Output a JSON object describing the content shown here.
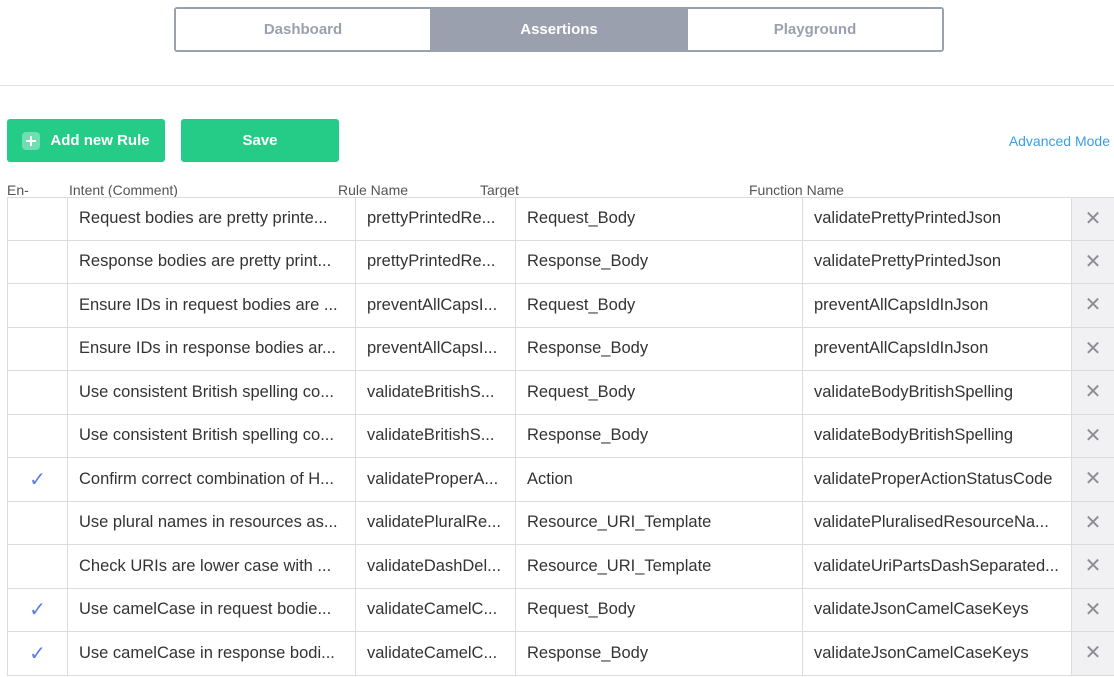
{
  "tabs": [
    {
      "label": "Dashboard",
      "active": false
    },
    {
      "label": "Assertions",
      "active": true
    },
    {
      "label": "Playground",
      "active": false
    }
  ],
  "toolbar": {
    "add_rule_label": "Add new Rule",
    "save_label": "Save",
    "advanced_mode_label": "Advanced Mode"
  },
  "columns": {
    "enabled": "En-",
    "intent": "Intent (Comment)",
    "rule_name": "Rule Name",
    "target": "Target",
    "function_name": "Function Name"
  },
  "rows": [
    {
      "enabled": "",
      "intent": "Request bodies are pretty printe...",
      "rule_name": "prettyPrintedRe...",
      "target": "Request_Body",
      "function_name": "validatePrettyPrintedJson",
      "delete": "✕"
    },
    {
      "enabled": "",
      "intent": "Response bodies are pretty print...",
      "rule_name": "prettyPrintedRe...",
      "target": "Response_Body",
      "function_name": "validatePrettyPrintedJson",
      "delete": "✕"
    },
    {
      "enabled": "",
      "intent": "Ensure IDs in request bodies are ...",
      "rule_name": "preventAllCapsI...",
      "target": "Request_Body",
      "function_name": "preventAllCapsIdInJson",
      "delete": "✕"
    },
    {
      "enabled": "",
      "intent": "Ensure IDs in response bodies ar...",
      "rule_name": "preventAllCapsI...",
      "target": "Response_Body",
      "function_name": "preventAllCapsIdInJson",
      "delete": "✕"
    },
    {
      "enabled": "",
      "intent": "Use consistent British spelling co...",
      "rule_name": "validateBritishS...",
      "target": "Request_Body",
      "function_name": "validateBodyBritishSpelling",
      "delete": "✕"
    },
    {
      "enabled": "",
      "intent": "Use consistent British spelling co...",
      "rule_name": "validateBritishS...",
      "target": "Response_Body",
      "function_name": "validateBodyBritishSpelling",
      "delete": "✕"
    },
    {
      "enabled": "✓",
      "intent": "Confirm correct combination of H...",
      "rule_name": "validateProperA...",
      "target": "Action",
      "function_name": "validateProperActionStatusCode",
      "delete": "✕"
    },
    {
      "enabled": "",
      "intent": "Use plural names in resources as...",
      "rule_name": "validatePluralRe...",
      "target": "Resource_URI_Template",
      "function_name": "validatePluralisedResourceNa...",
      "delete": "✕"
    },
    {
      "enabled": "",
      "intent": "Check URIs are lower case with ...",
      "rule_name": "validateDashDel...",
      "target": "Resource_URI_Template",
      "function_name": "validateUriPartsDashSeparated...",
      "delete": "✕"
    },
    {
      "enabled": "✓",
      "intent": "Use camelCase in request bodie...",
      "rule_name": "validateCamelC...",
      "target": "Request_Body",
      "function_name": "validateJsonCamelCaseKeys",
      "delete": "✕"
    },
    {
      "enabled": "✓",
      "intent": "Use camelCase in response bodi...",
      "rule_name": "validateCamelC...",
      "target": "Response_Body",
      "function_name": "validateJsonCamelCaseKeys",
      "delete": "✕"
    }
  ]
}
